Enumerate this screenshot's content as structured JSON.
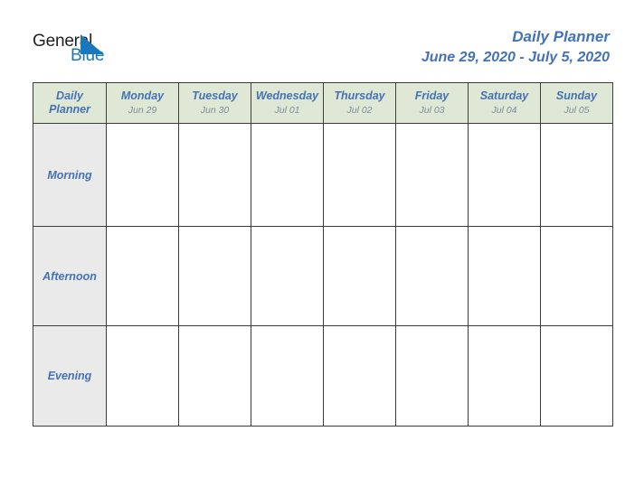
{
  "brand": {
    "name_dark": "General",
    "name_blue": "Blue",
    "triangle_icon": "triangle-logo-icon",
    "dark_color": "#231f20",
    "blue_color": "#1878be"
  },
  "header": {
    "title": "Daily Planner",
    "date_range": "June 29, 2020 - July 5, 2020",
    "title_color": "#4472b8"
  },
  "table": {
    "corner": {
      "line1": "Daily",
      "line2": "Planner"
    },
    "header_bg": "#dfe8d4",
    "label_bg": "#eaeaea",
    "border_color": "#3c3c3c",
    "day_name_color": "#4472b8",
    "day_date_color": "#7e8e9d",
    "days": [
      {
        "name": "Monday",
        "date": "Jun 29"
      },
      {
        "name": "Tuesday",
        "date": "Jun 30"
      },
      {
        "name": "Wednesday",
        "date": "Jul 01"
      },
      {
        "name": "Thursday",
        "date": "Jul 02"
      },
      {
        "name": "Friday",
        "date": "Jul 03"
      },
      {
        "name": "Saturday",
        "date": "Jul 04"
      },
      {
        "name": "Sunday",
        "date": "Jul 05"
      }
    ],
    "slots": [
      {
        "label": "Morning",
        "entries": [
          "",
          "",
          "",
          "",
          "",
          "",
          ""
        ]
      },
      {
        "label": "Afternoon",
        "entries": [
          "",
          "",
          "",
          "",
          "",
          "",
          ""
        ]
      },
      {
        "label": "Evening",
        "entries": [
          "",
          "",
          "",
          "",
          "",
          "",
          ""
        ]
      }
    ]
  }
}
